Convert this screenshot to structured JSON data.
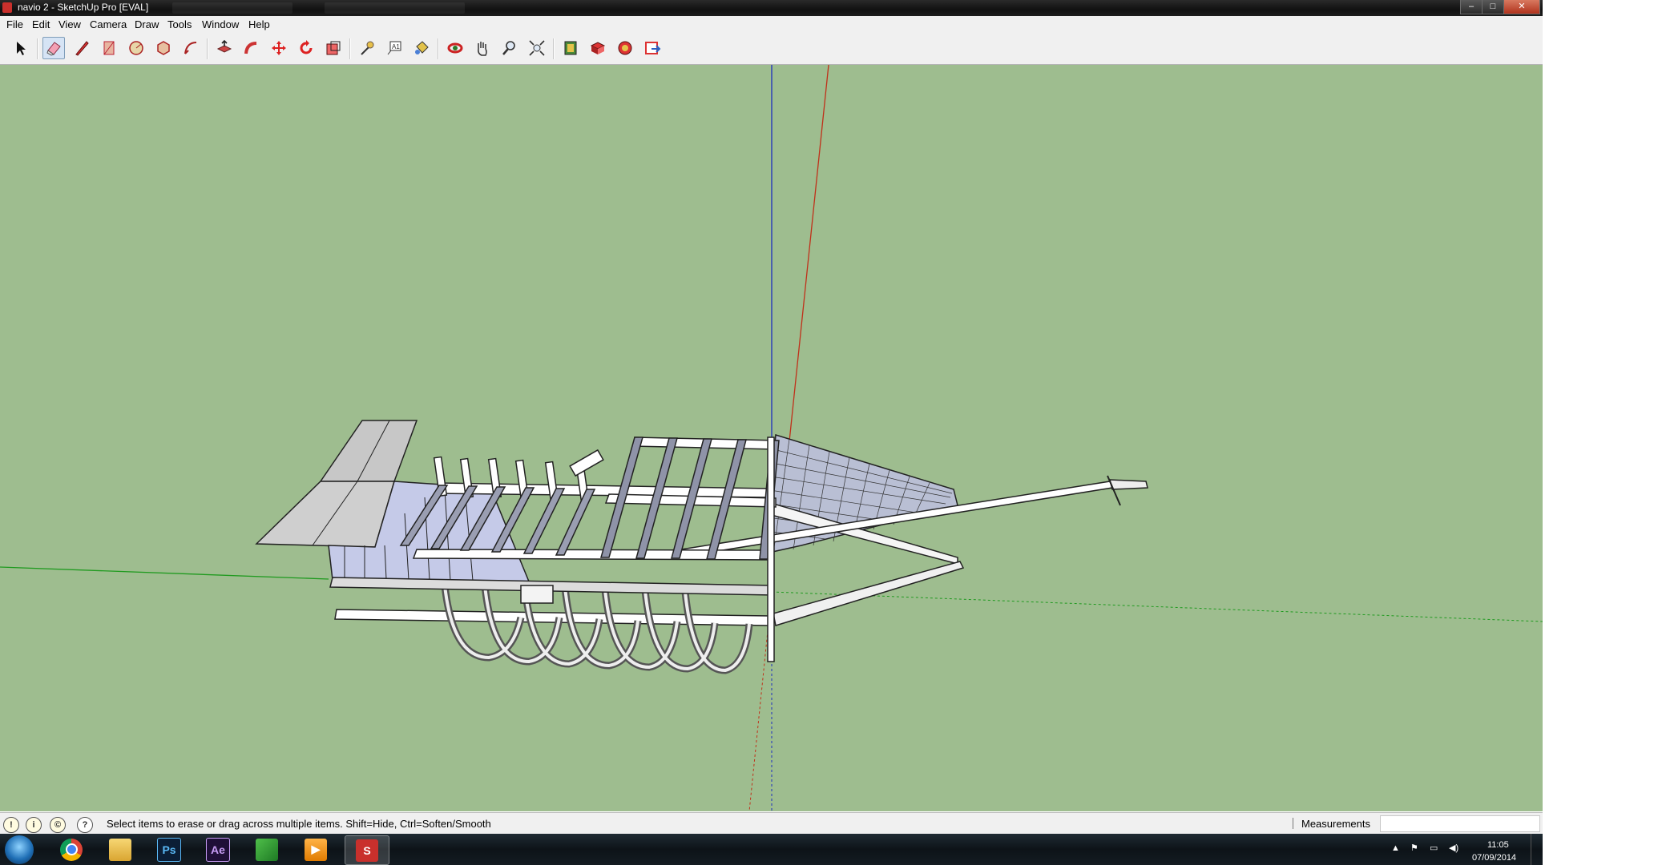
{
  "window": {
    "title": "navio 2 - SketchUp Pro [EVAL]",
    "minimize": "–",
    "maximize": "□",
    "close": "✕"
  },
  "menu": [
    "File",
    "Edit",
    "View",
    "Camera",
    "Draw",
    "Tools",
    "Window",
    "Help"
  ],
  "toolbar": {
    "tools": [
      "select",
      "eraser",
      "line",
      "rectangle",
      "circle",
      "polygon",
      "arc",
      "push-pull",
      "follow-me",
      "move",
      "rotate",
      "scale",
      "tape-measure",
      "text",
      "paint-bucket",
      "orbit",
      "pan",
      "zoom",
      "zoom-extents",
      "get-models",
      "share-model",
      "components",
      "send-to-layout"
    ],
    "active_tool": "eraser"
  },
  "viewport": {
    "background_color": "#9ebd8f",
    "axes": {
      "red": "#c0301a",
      "green": "#1f9a1f",
      "blue": "#1d2fbf"
    }
  },
  "status": {
    "hint": "Select items to erase or drag across multiple items. Shift=Hide, Ctrl=Soften/Smooth",
    "measurements_label": "Measurements",
    "measurements_value": ""
  },
  "taskbar": {
    "apps": [
      {
        "name": "chrome",
        "label": ""
      },
      {
        "name": "explorer",
        "label": ""
      },
      {
        "name": "photoshop",
        "label": "Ps"
      },
      {
        "name": "after-effects",
        "label": "Ae"
      },
      {
        "name": "green-app",
        "label": ""
      },
      {
        "name": "media-player",
        "label": ""
      },
      {
        "name": "sketchup",
        "label": ""
      }
    ],
    "time": "11:05",
    "date": "07/09/2014"
  }
}
